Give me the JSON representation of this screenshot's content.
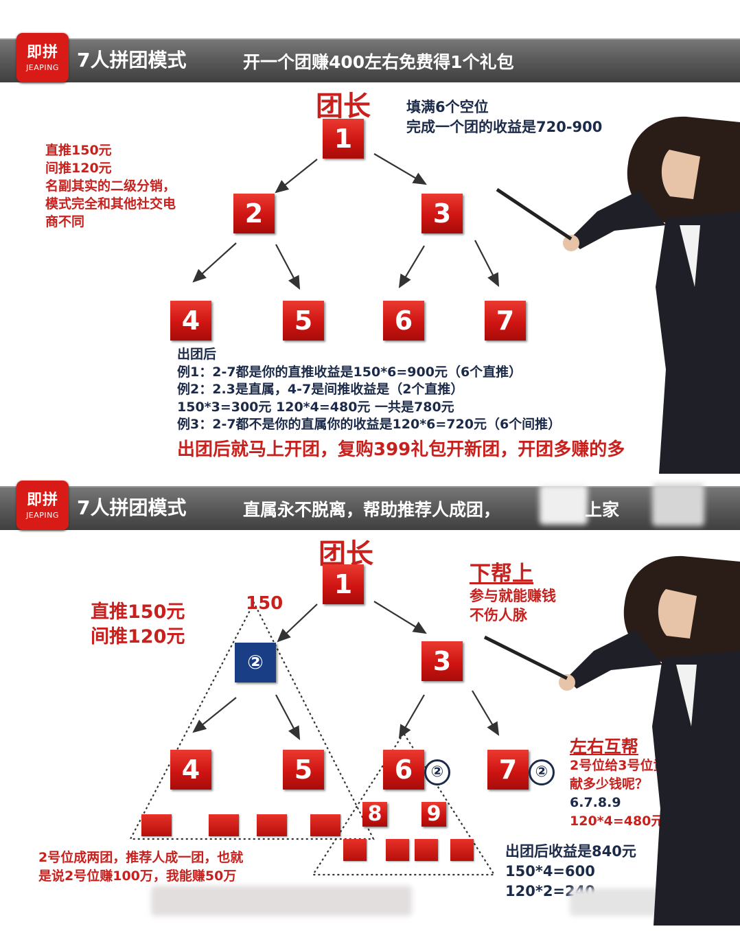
{
  "brand": {
    "logo_zh": "即拼",
    "logo_en": "JEAPING"
  },
  "panel1": {
    "title": "7人拼团模式",
    "subtitle": "开一个团赚400左右免费得1个礼包",
    "leader_label": "团长",
    "fill_note": [
      "填满6个空位",
      "完成一个团的收益是720-900"
    ],
    "left_note": [
      "直推150元",
      "间推120元",
      "名副其实的二级分销，",
      "模式完全和其他社交电",
      "商不同"
    ],
    "nodes": [
      "1",
      "2",
      "3",
      "4",
      "5",
      "6",
      "7"
    ],
    "examples": [
      "出团后",
      "例1：2-7都是你的直推收益是150*6=900元（6个直推）",
      "例2：2.3是直属，4-7是间推收益是（2个直推）",
      "150*3=300元 120*4=480元  一共是780元",
      "例3：2-7都不是你的直属你的收益是120*6=720元（6个间推）"
    ],
    "slogan": "出团后就马上开团，复购399礼包开新团，开团多赚的多"
  },
  "panel2": {
    "title": "7人拼团模式",
    "subtitle": "直属永不脱离，帮助推荐人成团，",
    "subtitle_tail": "上家",
    "leader_label": "团长",
    "left_note": [
      "直推150元",
      "间推120元"
    ],
    "triangle_label": "150",
    "nodes": {
      "n1": "1",
      "n2": "②",
      "n3": "3",
      "n4": "4",
      "n5": "5",
      "n6": "6",
      "n7": "7",
      "n8": "8",
      "n9": "9"
    },
    "badge": "②",
    "help_up": {
      "title": "下帮上",
      "lines": [
        "参与就能赚钱",
        "不伤人脉"
      ]
    },
    "mutual_help": {
      "title": "左右互帮",
      "lines": [
        "2号位给3号位贡",
        "献多少钱呢？",
        "6.7.8.9",
        "120*4=480元"
      ]
    },
    "bottom_left": [
      "2号位成两团，推荐人成一团，也就",
      "是说2号位赚100万，我能赚50万"
    ],
    "bottom_right": [
      "出团后收益是840元",
      "150*4=600",
      "120*2=240"
    ]
  },
  "colors": {
    "red": "#c8201d",
    "navy": "#1b2a48",
    "header": "#5a5a5a",
    "box_navy": "#1a3e85"
  }
}
